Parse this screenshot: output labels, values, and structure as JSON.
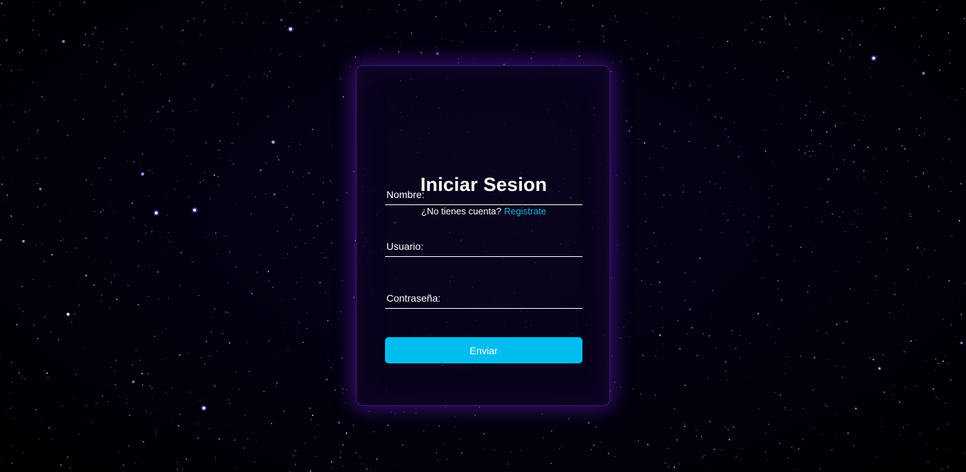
{
  "login": {
    "title": "Iniciar Sesion",
    "signup_prompt": "¿No tienes cuenta?",
    "signup_link": "Registrate",
    "fields": {
      "name": {
        "label": "Nombre:",
        "value": ""
      },
      "user": {
        "label": "Usuario:",
        "value": ""
      },
      "password": {
        "label": "Contraseña:",
        "value": ""
      }
    },
    "submit_label": "Enviar"
  },
  "colors": {
    "background": "#000000",
    "card": "#0a041e",
    "glow": "#6e1edc",
    "accent": "#00bdef",
    "link": "#1fb6e8",
    "text": "#ffffff"
  }
}
